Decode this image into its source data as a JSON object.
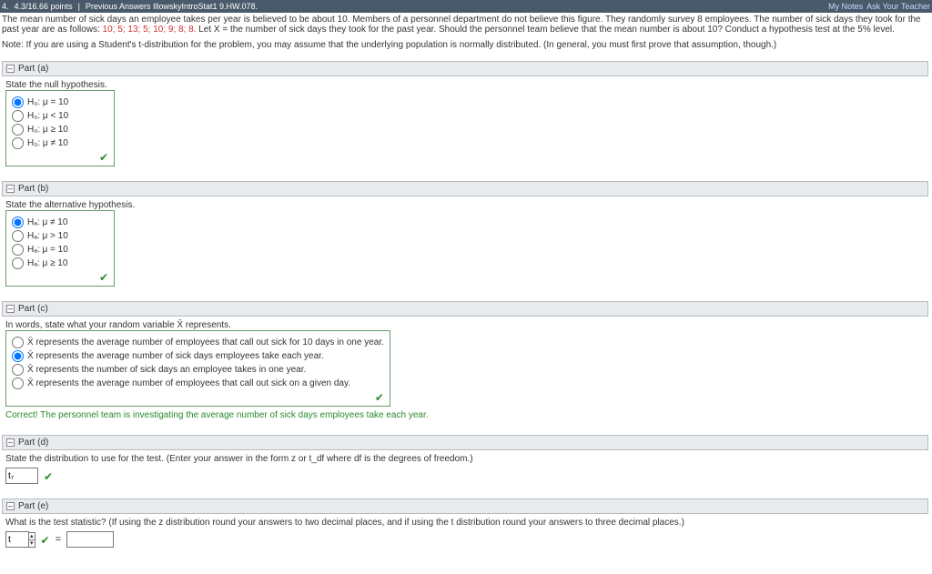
{
  "topbar": {
    "number": "4.",
    "points": "4.3/16.66 points",
    "sep": "|",
    "prev": "Previous Answers IllowskyIntroStat1 9.HW.078.",
    "notes": "My Notes",
    "ask": "Ask Your Teacher"
  },
  "question": {
    "p1a": "The mean number of sick days an employee takes per year is believed to be about 10. Members of a personnel department do not believe this figure. They randomly survey 8 employees. The number of sick days they took for the past year are as follows: ",
    "p1red": "10; 5; 13; 5; 10; 9; 8; 8.",
    "p1b": " Let X = the number of sick days they took for the past year. Should the personnel team believe that the mean number is about 10? Conduct a hypothesis test at the 5% level.",
    "note": "Note: If you are using a Student's t-distribution for the problem, you may assume that the underlying population is normally distributed. (In general, you must first prove that assumption, though.)"
  },
  "parts": {
    "a": {
      "title": "Part (a)",
      "prompt": "State the null hypothesis.",
      "o1": "H₀: μ = 10",
      "o2": "H₀: μ < 10",
      "o3": "H₀: μ ≥ 10",
      "o4": "H₀: μ ≠ 10"
    },
    "b": {
      "title": "Part (b)",
      "prompt": "State the alternative hypothesis.",
      "o1": "Hₐ: μ ≠ 10",
      "o2": "Hₐ: μ > 10",
      "o3": "Hₐ: μ = 10",
      "o4": "Hₐ: μ ≥ 10"
    },
    "c": {
      "title": "Part (c)",
      "prompt": "In words, state what your random variable X̄ represents.",
      "o1": "X̄ represents the average number of employees that call out sick for 10 days in one year.",
      "o2": "X̄ represents the average number of sick days employees take each year.",
      "o3": "X̄ represents the number of sick days an employee takes in one year.",
      "o4": "X̄ represents the average number of employees that call out sick on a given day.",
      "fb": "Correct! The personnel team is investigating the average number of sick days employees take each year."
    },
    "d": {
      "title": "Part (d)",
      "prompt": "State the distribution to use for the test. (Enter your answer in the form z or t_df where df is the degrees of freedom.)",
      "ans": "t₇"
    },
    "e": {
      "title": "Part (e)",
      "prompt": "What is the test statistic? (If using the z distribution round your answers to two decimal places, and if using the t distribution round your answers to three decimal places.)",
      "sel": "t",
      "eq": "="
    }
  },
  "icons": {
    "minus": "–",
    "check": "✔",
    "up": "▴",
    "dn": "▾"
  }
}
